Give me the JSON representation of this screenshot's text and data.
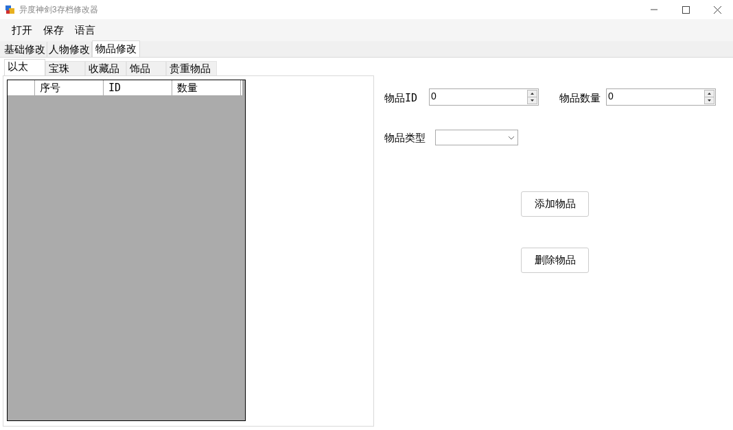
{
  "window": {
    "title": "异度神剑3存档修改器"
  },
  "menu": [
    "打开",
    "保存",
    "语言"
  ],
  "tabs": [
    {
      "label": "基础修改",
      "selected": false
    },
    {
      "label": "人物修改",
      "selected": false
    },
    {
      "label": "物品修改",
      "selected": true
    }
  ],
  "subtabs": [
    {
      "label": "以太",
      "selected": true
    },
    {
      "label": "宝珠",
      "selected": false
    },
    {
      "label": "收藏品",
      "selected": false
    },
    {
      "label": "饰品",
      "selected": false
    },
    {
      "label": "贵重物品",
      "selected": false
    }
  ],
  "table": {
    "columns": [
      "序号",
      "ID",
      "数量"
    ]
  },
  "fields": {
    "item_id": {
      "label": "物品ID",
      "value": "0"
    },
    "item_count": {
      "label": "物品数量",
      "value": "0"
    },
    "item_type": {
      "label": "物品类型"
    }
  },
  "buttons": [
    "添加物品",
    "删除物品"
  ]
}
